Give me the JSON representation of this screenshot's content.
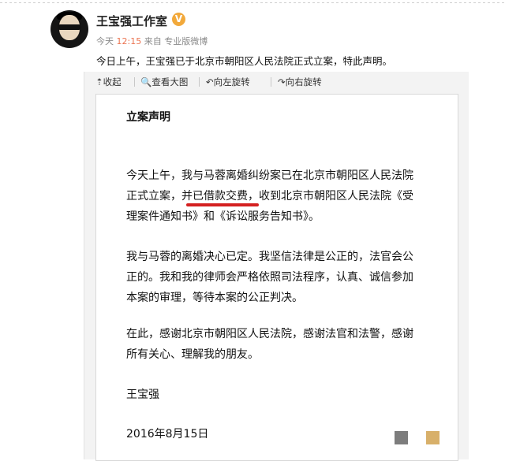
{
  "post": {
    "username": "王宝强工作室",
    "verified": "V",
    "meta_prefix": "今天 ",
    "time": "12:15",
    "meta_suffix": " 来自 专业版微博",
    "text": "今日上午，王宝强已于北京市朝阳区人民法院正式立案，特此声明。"
  },
  "toolbar": {
    "collapse": "⇡收起",
    "view_large": "🔍查看大图",
    "rotate_left": "↶向左旋转",
    "rotate_right": "↷向右旋转"
  },
  "document": {
    "title": "立案声明",
    "p1_lines": [
      "今天上午，我与马蓉离婚纠纷案已在北京市朝阳区人民法院",
      "正式立案，并已借款交费，收到北京市朝阳区人民法院《受",
      "理案件通知书》和《诉讼服务告知书》。"
    ],
    "p2_lines": [
      "我与马蓉的离婚决心已定。我坚信法律是公正的，法官会公",
      "正的。我和我的律师会严格依照司法程序，认真、诚信参加",
      "本案的审理，等待本案的公正判决。"
    ],
    "p3_lines": [
      "在此，感谢北京市朝阳区人民法院，感谢法官和法警，感谢",
      "所有关心、理解我的朋友。"
    ],
    "signature": "王宝强",
    "date": "2016年8月15日"
  },
  "colors": {
    "time_accent": "#eb7350",
    "verified_badge": "#f2a93b",
    "highlight_underline": "#d42020"
  }
}
